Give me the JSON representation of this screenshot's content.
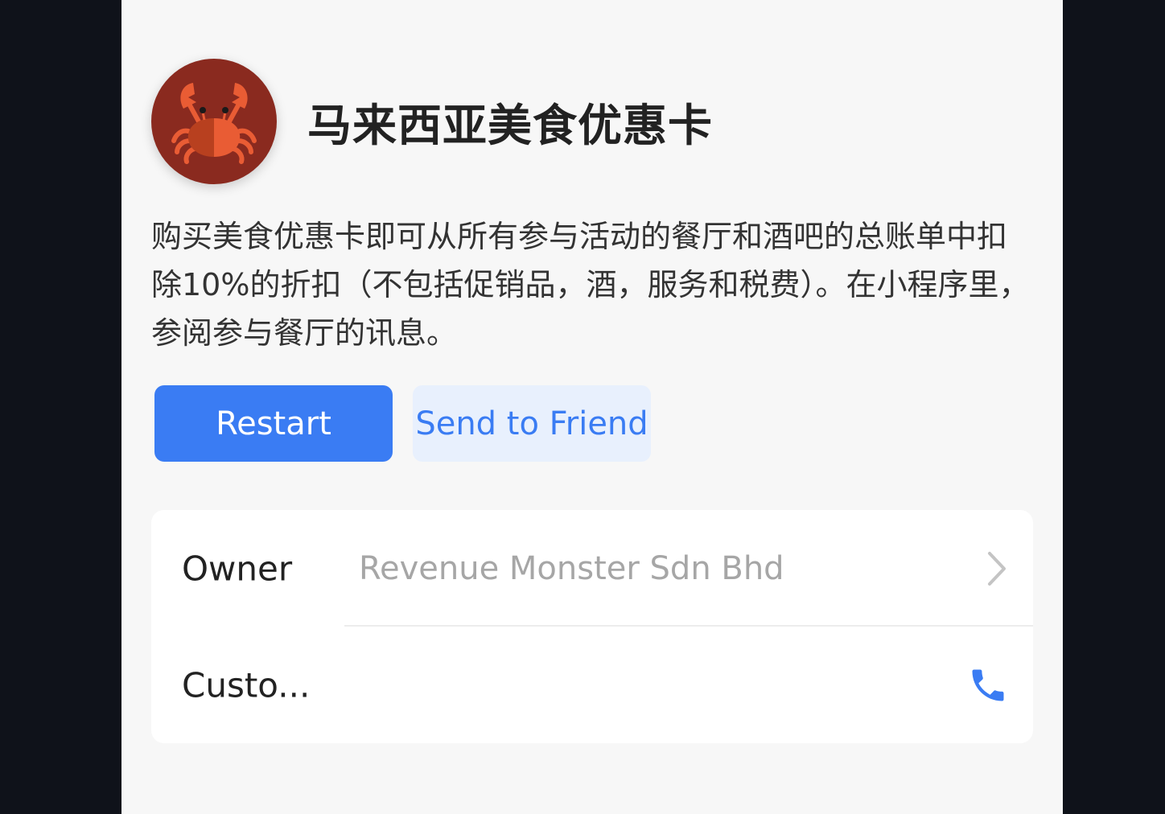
{
  "header": {
    "title": "马来西亚美食优惠卡"
  },
  "description": "购买美食优惠卡即可从所有参与活动的餐厅和酒吧的总账单中扣除10%的折扣（不包括促销品，酒，服务和税费）。在小程序里，参阅参与餐厅的讯息。",
  "actions": {
    "restart_label": "Restart",
    "send_label": "Send to Friend"
  },
  "info": {
    "owner_label": "Owner",
    "owner_value": "Revenue Monster Sdn Bhd",
    "customer_label": "Custo..."
  },
  "icons": {
    "avatar": "crab-icon",
    "owner_action": "chevron-right-icon",
    "customer_action": "phone-icon"
  },
  "colors": {
    "accent": "#3a7cf3",
    "avatar_bg": "#8a2a1f",
    "crab": "#e95c34"
  }
}
